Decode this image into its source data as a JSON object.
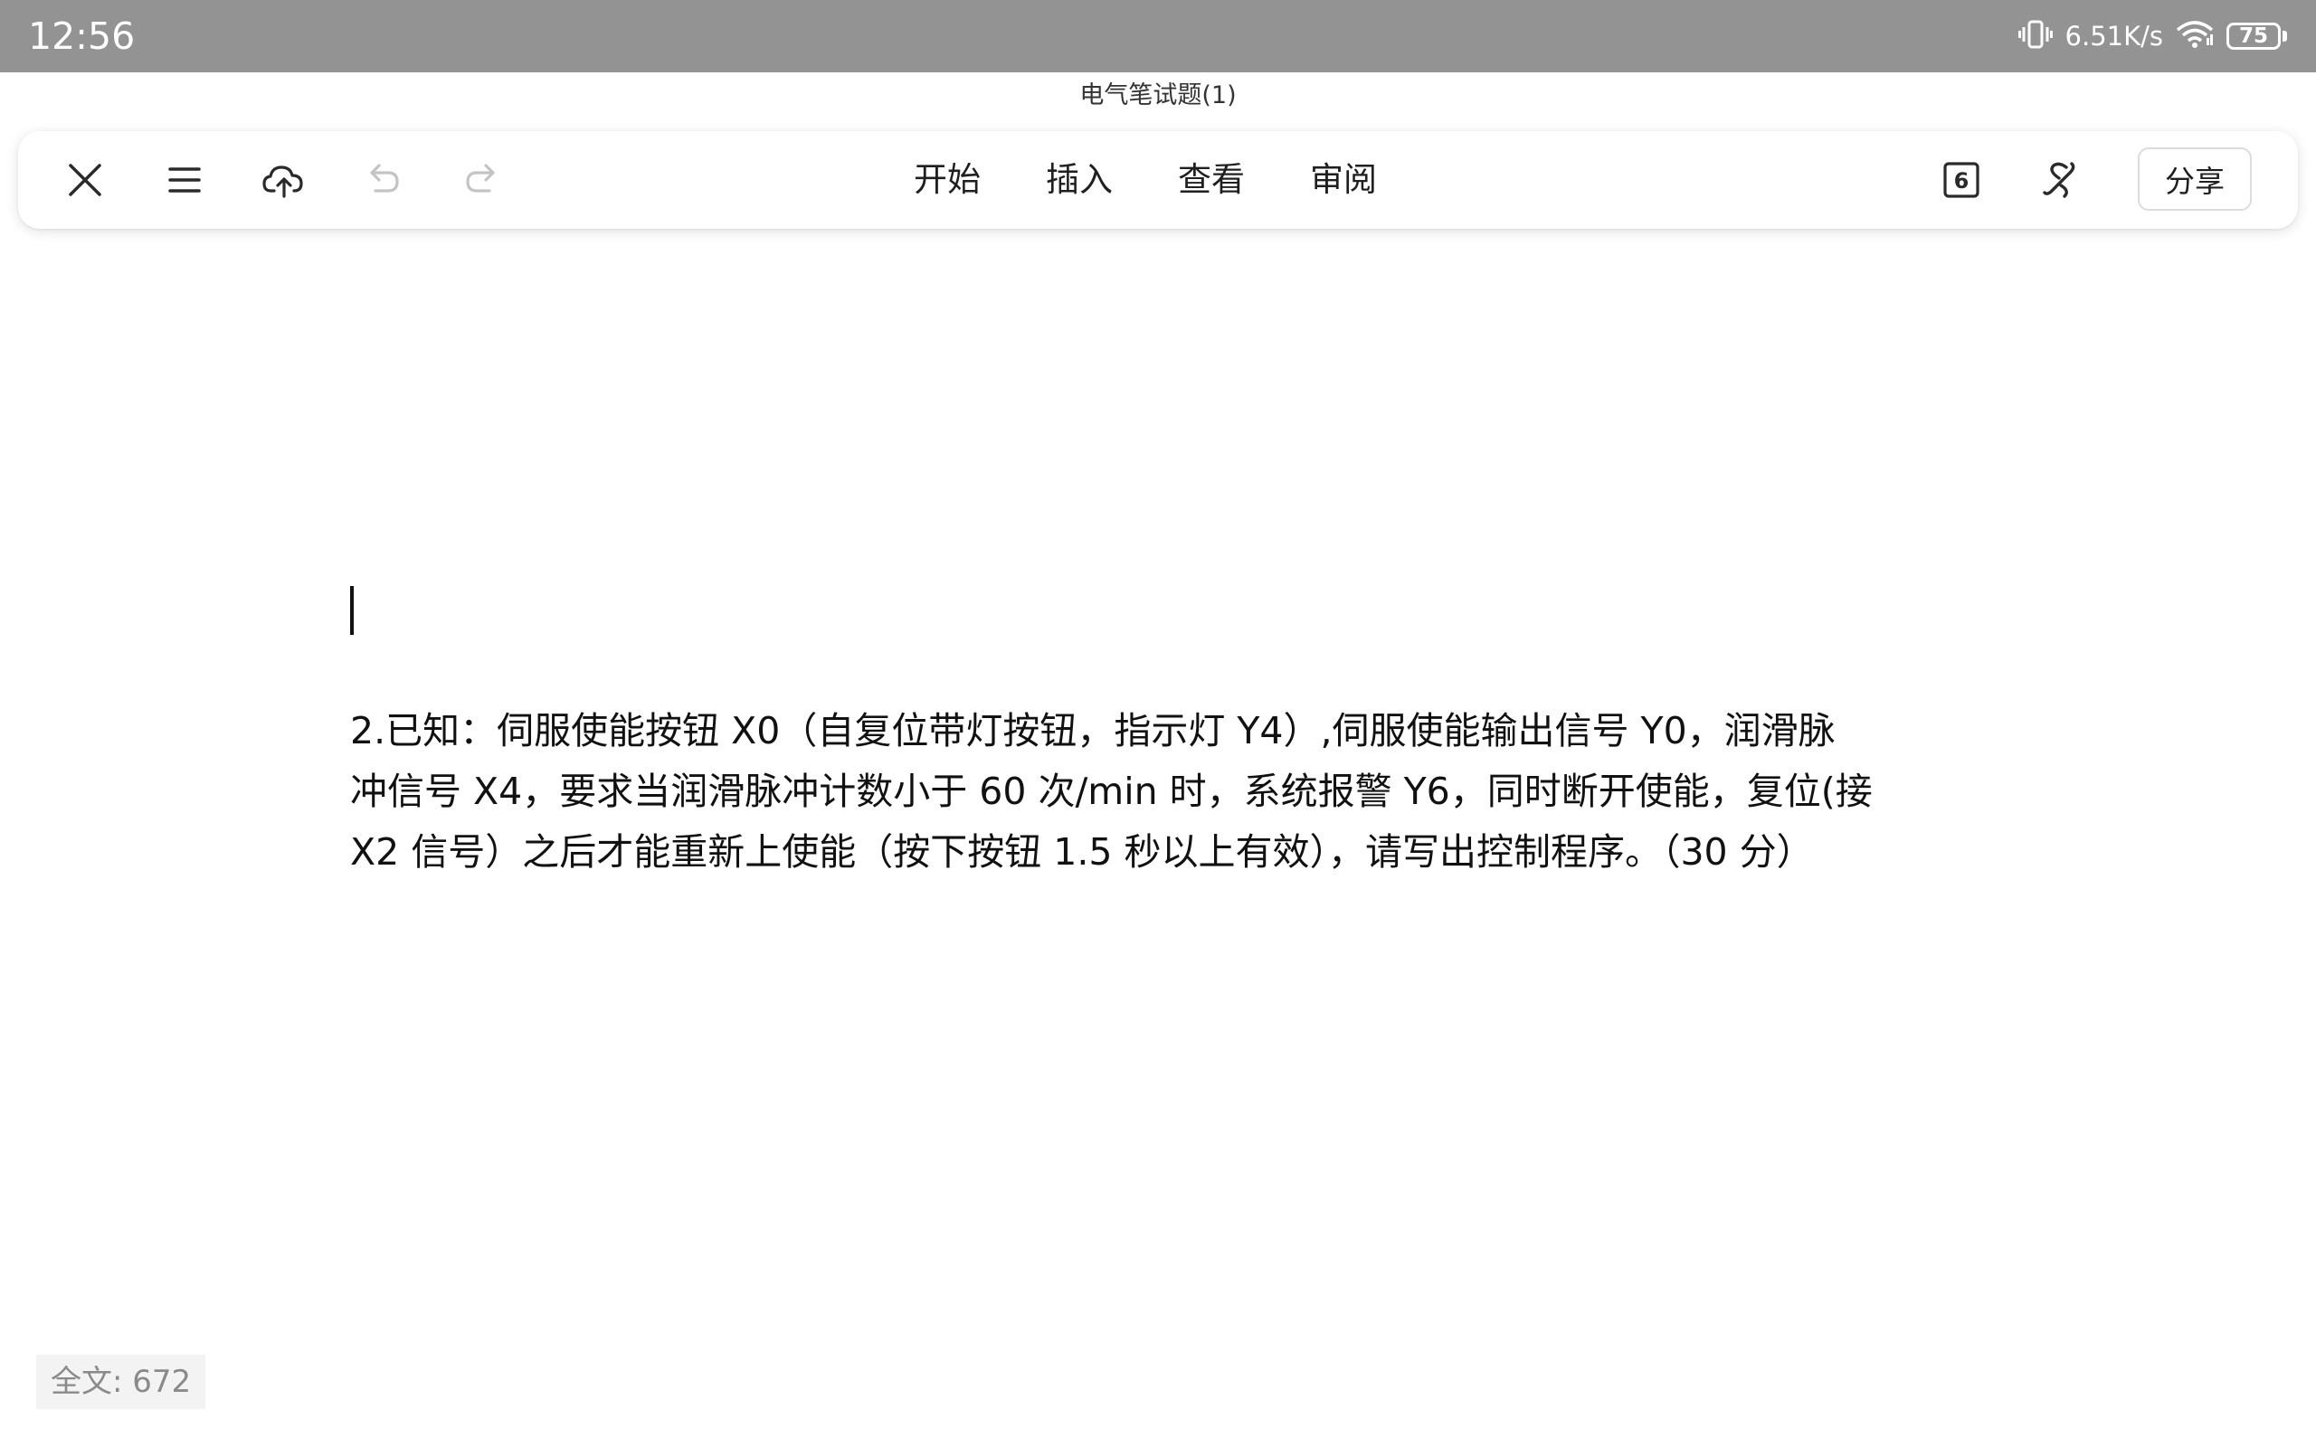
{
  "status_bar": {
    "time": "12:56",
    "network_speed": "6.51K/s",
    "battery_level": "75",
    "icons": [
      "vibrate-icon",
      "wifi-icon",
      "battery-icon"
    ]
  },
  "document": {
    "title": "电气笔试题(1)",
    "paragraph_lines": [
      "2.已知：伺服使能按钮 X0（自复位带灯按钮，指示灯 Y4）,伺服使能输出信号 Y0，润滑脉",
      "冲信号 X4，要求当润滑脉冲计数小于 60 次/min 时，系统报警 Y6，同时断开使能，复位(接",
      "X2 信号）之后才能重新上使能（按下按钮 1.5 秒以上有效），请写出控制程序。（30 分）"
    ]
  },
  "toolbar": {
    "left_icons": [
      "close-icon",
      "menu-icon",
      "cloud-upload-icon",
      "undo-icon",
      "redo-icon"
    ],
    "tabs": [
      "开始",
      "插入",
      "查看",
      "审阅"
    ],
    "page_badge": "6",
    "right_icons": [
      "page-count-icon",
      "pen-icon"
    ],
    "share_label": "分享"
  },
  "footer": {
    "word_count": "全文: 672"
  },
  "colors": {
    "status_bar_bg": "#939393",
    "text": "#111111",
    "disabled_icon": "#c4c4c4"
  }
}
